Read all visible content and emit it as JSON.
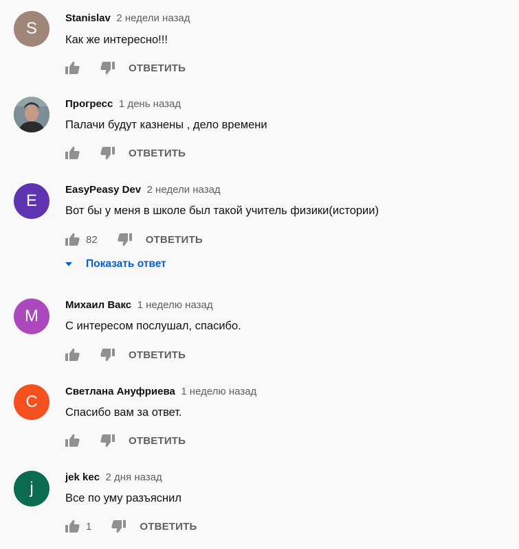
{
  "comments": [
    {
      "avatar_letter": "S",
      "avatar_color": "#a08679",
      "author": "Stanislav",
      "time": "2 недели назад",
      "text": "Как же интересно!!!",
      "likes": "",
      "reply_label": "ОТВЕТИТЬ"
    },
    {
      "avatar_letter": "",
      "avatar_color": "#6d7f86",
      "author": "Прогресс",
      "time": "1 день назад",
      "text": "Палачи будут казнены , дело времени",
      "likes": "",
      "reply_label": "ОТВЕТИТЬ"
    },
    {
      "avatar_letter": "E",
      "avatar_color": "#5e34b1",
      "author": "EasyPeasy Dev",
      "time": "2 недели назад",
      "text": "Вот бы у меня в школе был такой учитель физики(истории)",
      "likes": "82",
      "reply_label": "ОТВЕТИТЬ",
      "show_replies": "Показать ответ"
    },
    {
      "avatar_letter": "M",
      "avatar_color": "#ab48bc",
      "author": "Михаил Вакс",
      "time": "1 неделю назад",
      "text": "С интересом послушал, спасибо.",
      "likes": "",
      "reply_label": "ОТВЕТИТЬ"
    },
    {
      "avatar_letter": "C",
      "avatar_color": "#f4511e",
      "author": "Светлана Ануфриева",
      "time": "1 неделю назад",
      "text": "Спасибо вам за ответ.",
      "likes": "",
      "reply_label": "ОТВЕТИТЬ"
    },
    {
      "avatar_letter": "j",
      "avatar_color": "#0b6b50",
      "author": "jek kec",
      "time": "2 дня назад",
      "text": "Все по уму разъяснил",
      "likes": "1",
      "reply_label": "ОТВЕТИТЬ"
    }
  ],
  "icons": {
    "like": "thumbs-up-icon",
    "dislike": "thumbs-down-icon",
    "expand": "caret-down-icon"
  }
}
